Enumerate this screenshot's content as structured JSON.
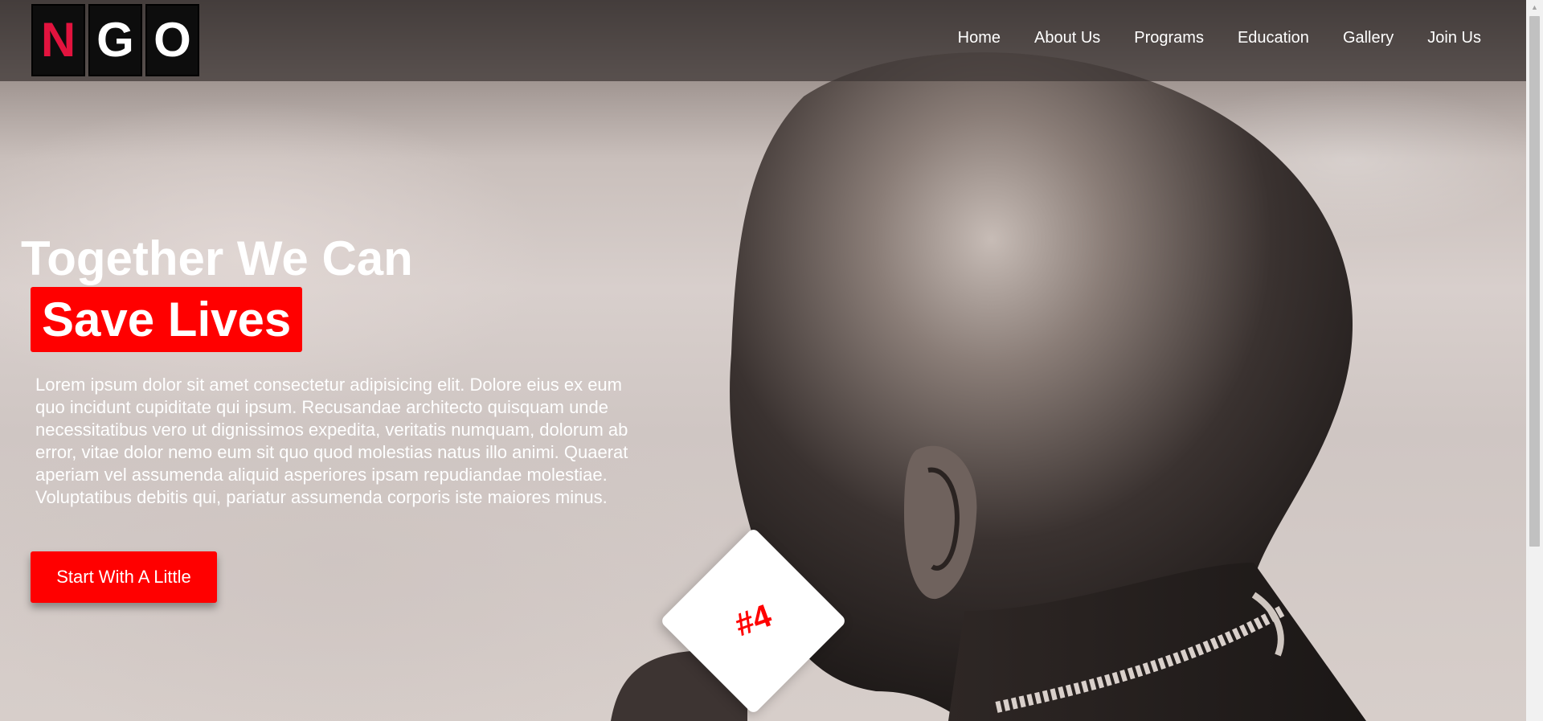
{
  "logo": {
    "letters": [
      "N",
      "G",
      "O"
    ],
    "accent_color": "#e2133e"
  },
  "nav": {
    "items": [
      {
        "label": "Home"
      },
      {
        "label": "About Us"
      },
      {
        "label": "Programs"
      },
      {
        "label": "Education"
      },
      {
        "label": "Gallery"
      },
      {
        "label": "Join Us"
      }
    ]
  },
  "hero": {
    "title": "Together We Can",
    "highlight": "Save Lives",
    "description": "Lorem ipsum dolor sit amet consectetur adipisicing elit. Dolore eius ex eum quo incidunt cupiditate qui ipsum. Recusandae architecto quisquam unde necessitatibus vero ut dignissimos expedita, veritatis numquam, dolorum ab error, vitae dolor nemo eum sit quo quod molestias natus illo animi. Quaerat aperiam vel assumenda aliquid asperiores ipsam repudiandae molestiae. Voluptatibus debitis qui, pariatur assumenda corporis iste maiores minus.",
    "cta_label": "Start With A Little",
    "highlight_color": "#ff0000"
  },
  "badge": {
    "text": "#4",
    "text_color": "#ff0000"
  },
  "background": {
    "image_subject": "child-profile-photo"
  }
}
